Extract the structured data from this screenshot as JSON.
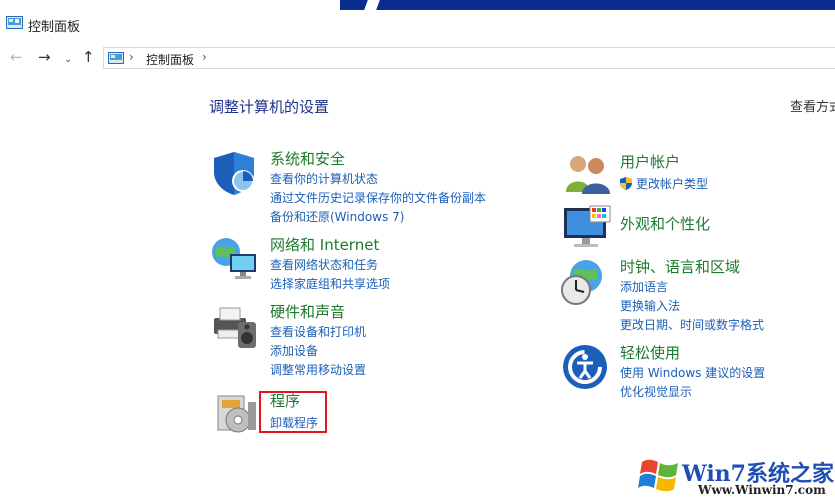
{
  "window": {
    "title": "控制面板"
  },
  "nav": {
    "back_glyph": "←",
    "forward_glyph": "→",
    "history_glyph": "⌄",
    "up_glyph": "↑",
    "address_chevron": "›",
    "address_location": "控制面板"
  },
  "main": {
    "title": "调整计算机的设置",
    "view_by": "查看方式"
  },
  "categories": [
    {
      "icon": "shield-security-icon",
      "title": "系统和安全",
      "links": [
        "查看你的计算机状态",
        "通过文件历史记录保存你的文件备份副本",
        "备份和还原(Windows 7)"
      ]
    },
    {
      "icon": "network-globe-icon",
      "title": "网络和 Internet",
      "links": [
        "查看网络状态和任务",
        "选择家庭组和共享选项"
      ]
    },
    {
      "icon": "printer-speaker-icon",
      "title": "硬件和声音",
      "links": [
        "查看设备和打印机",
        "添加设备",
        "调整常用移动设置"
      ]
    },
    {
      "icon": "programs-disc-icon",
      "title": "程序",
      "links": [
        "卸载程序"
      ]
    },
    {
      "icon": "users-icon",
      "title": "用户帐户",
      "links": [
        "更改帐户类型"
      ]
    },
    {
      "icon": "monitor-palette-icon",
      "title": "外观和个性化",
      "links": []
    },
    {
      "icon": "clock-globe-icon",
      "title": "时钟、语言和区域",
      "links": [
        "添加语言",
        "更换输入法",
        "更改日期、时间或数字格式"
      ]
    },
    {
      "icon": "ease-of-access-icon",
      "title": "轻松使用",
      "links": [
        "使用 Windows 建议的设置",
        "优化视觉显示"
      ]
    }
  ],
  "watermark": {
    "brand": "Win7系统之家",
    "url": "Www.Winwin7.com"
  },
  "colors": {
    "category_green": "#1e7a2f",
    "link_blue": "#1c5fb8",
    "highlight_red": "#e0161b",
    "title_blue": "#1e3287"
  }
}
